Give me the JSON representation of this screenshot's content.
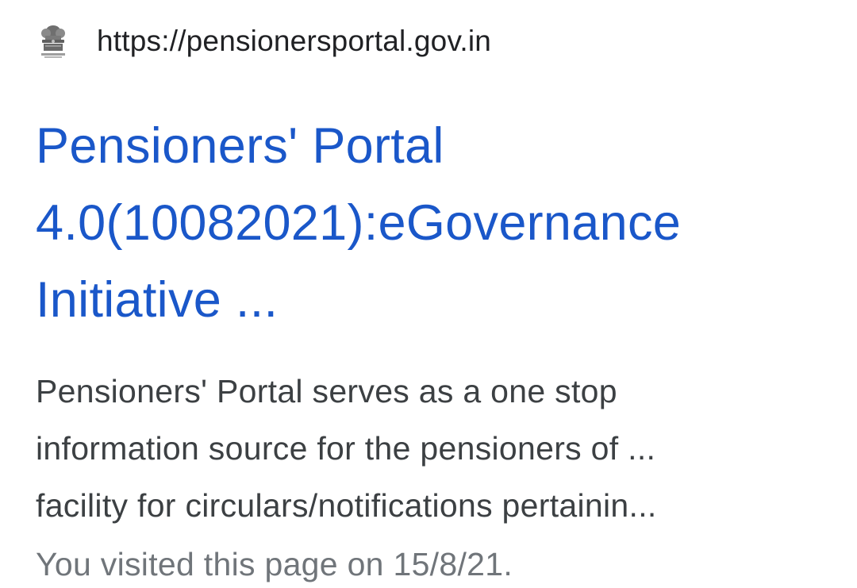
{
  "result": {
    "favicon": "government-emblem-icon",
    "url": "https://pensionersportal.gov.in",
    "title_lines": [
      "Pensioners' Portal",
      "4.0(10082021):eGovernance",
      "Initiative ..."
    ],
    "snippet_lines": [
      "Pensioners' Portal serves as a one stop",
      "information source for the pensioners of ...",
      "facility for circulars/notifications pertainin..."
    ],
    "visited_note": "You visited this page on 15/8/21."
  },
  "colors": {
    "title_link": "#1a57c9",
    "url_text": "#202124",
    "snippet_text": "#3c4043",
    "visited_text": "#70757a",
    "background": "#ffffff"
  }
}
